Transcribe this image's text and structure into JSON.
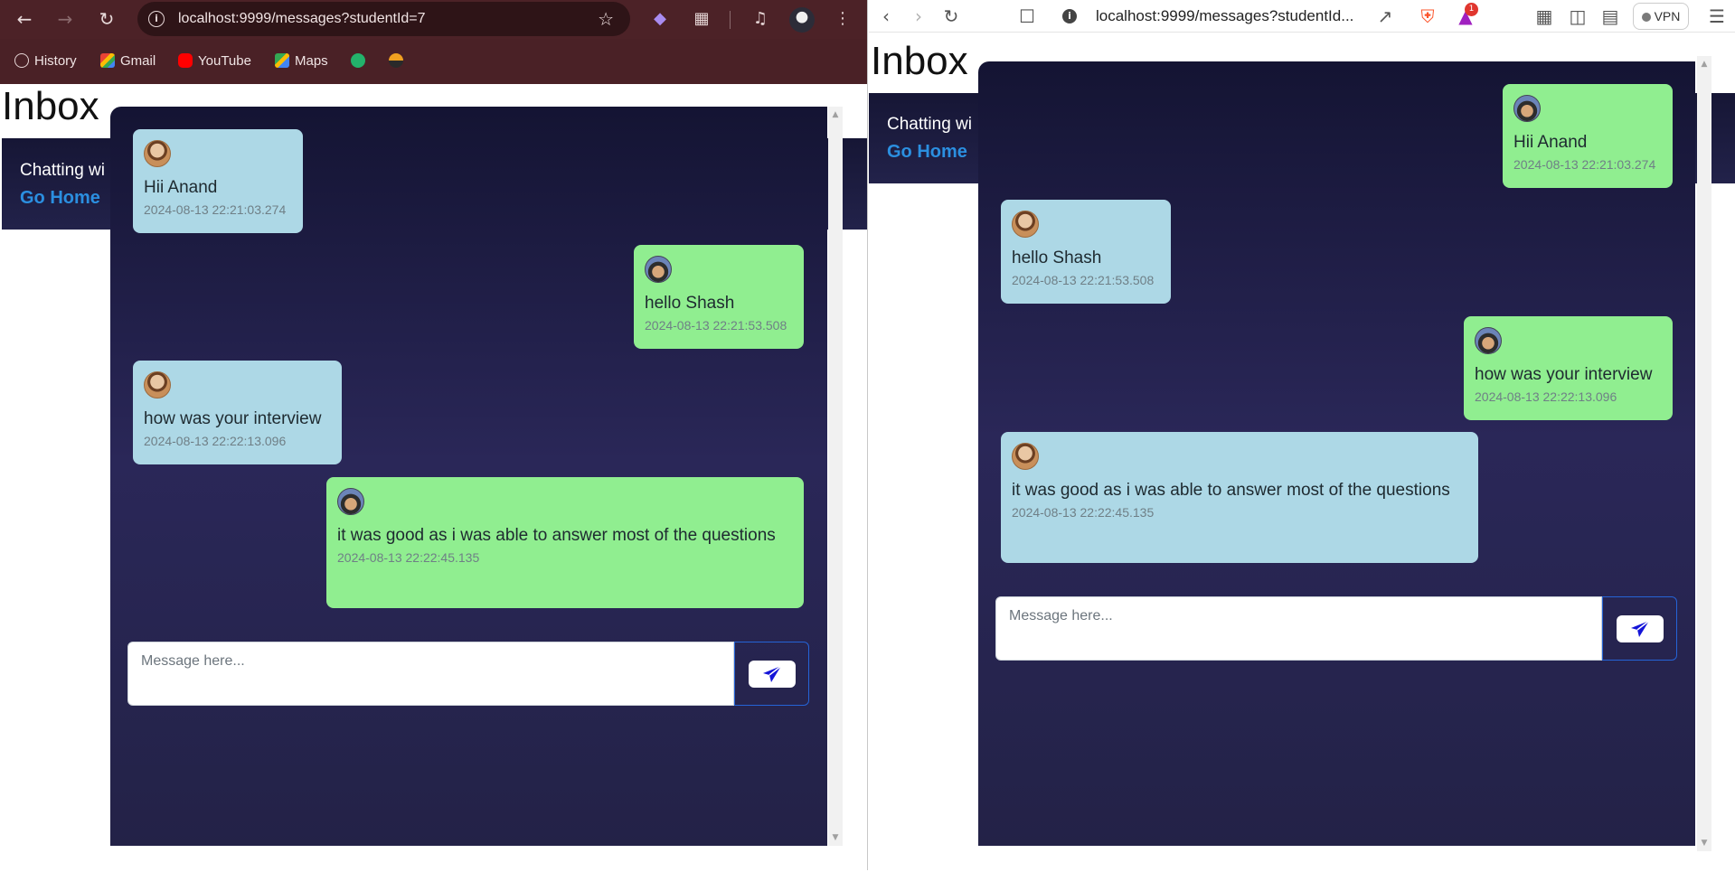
{
  "left_browser": {
    "url": "localhost:9999/messages?studentId=7",
    "bookmarks": [
      "History",
      "Gmail",
      "YouTube",
      "Maps"
    ]
  },
  "right_browser": {
    "url": "localhost:9999/messages?studentId...",
    "vpn_label": "VPN",
    "notification_count": "1"
  },
  "page": {
    "title": "Inbox",
    "chatting_with": "Chatting wi",
    "go_home": "Go Home",
    "input_placeholder": "Message here..."
  },
  "left_messages": [
    {
      "side": "recv",
      "text": "Hii Anand",
      "time": "2024-08-13 22:21:03.274"
    },
    {
      "side": "sent",
      "text": "hello Shash",
      "time": "2024-08-13 22:21:53.508"
    },
    {
      "side": "recv",
      "text": "how was your interview",
      "time": "2024-08-13 22:22:13.096"
    },
    {
      "side": "sent",
      "text": "it was good as i was able to answer most of the questions",
      "time": "2024-08-13 22:22:45.135"
    }
  ],
  "right_messages": [
    {
      "side": "sent",
      "text": "Hii Anand",
      "time": "2024-08-13 22:21:03.274"
    },
    {
      "side": "recv",
      "text": "hello Shash",
      "time": "2024-08-13 22:21:53.508"
    },
    {
      "side": "sent",
      "text": "how was your interview",
      "time": "2024-08-13 22:22:13.096"
    },
    {
      "side": "recv",
      "text": "it was good as i was able to answer most of the questions",
      "time": "2024-08-13 22:22:45.135"
    }
  ],
  "colors": {
    "received_bubble": "#add8e6",
    "sent_bubble": "#90ee90",
    "link": "#2b8fe0",
    "send_border": "#2563d6",
    "send_icon": "#1414d8"
  }
}
